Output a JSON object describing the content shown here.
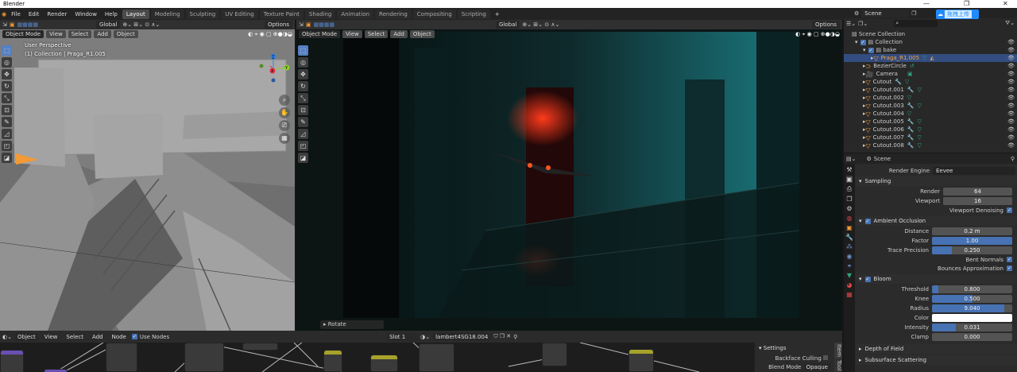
{
  "app": {
    "title": "Blender",
    "window_controls": [
      "—",
      "❐",
      "✕"
    ]
  },
  "menu": {
    "items": [
      "File",
      "Edit",
      "Render",
      "Window",
      "Help"
    ],
    "workspaces": [
      "Layout",
      "Modeling",
      "Sculpting",
      "UV Editing",
      "Texture Paint",
      "Shading",
      "Animation",
      "Rendering",
      "Compositing",
      "Scripting"
    ],
    "add_tab": "+"
  },
  "viewport_left": {
    "mode": "Object Mode",
    "menus": [
      "View",
      "Select",
      "Add",
      "Object"
    ],
    "transform": "Global",
    "options": "Options",
    "overlay_title": "User Perspective",
    "overlay_sub": "(1) Collection | Praga_R1.005",
    "gizmo": {
      "z": "Z",
      "y": "Y",
      "x": "X"
    }
  },
  "viewport_right": {
    "mode": "Object Mode",
    "menus": [
      "View",
      "Select",
      "Add",
      "Object"
    ],
    "transform": "Global",
    "options": "Options",
    "operator": "Rotate"
  },
  "node_editor": {
    "object": "Object",
    "menus": [
      "View",
      "Select",
      "Add",
      "Node"
    ],
    "use_nodes": "Use Nodes",
    "slot": "Slot 1",
    "material": "lambert4SG18.004",
    "npanel": {
      "section": "Settings",
      "backface": "Backface Culling",
      "blend_label": "Blend Mode",
      "blend_value": "Opaque",
      "tabs": [
        "Item",
        "Tool"
      ]
    }
  },
  "outliner": {
    "scene": "Scene",
    "upload_label": "拖拽上传",
    "root": "Scene Collection",
    "items": [
      {
        "name": "Collection",
        "type": "collection"
      },
      {
        "name": "bake",
        "type": "collection"
      },
      {
        "name": "Praga_R1.005",
        "type": "mesh",
        "selected": true
      },
      {
        "name": "BezierCircle",
        "type": "curve"
      },
      {
        "name": "Camera",
        "type": "camera"
      },
      {
        "name": "Cutout",
        "type": "mesh"
      },
      {
        "name": "Cutout.001",
        "type": "mesh"
      },
      {
        "name": "Cutout.002",
        "type": "mesh"
      },
      {
        "name": "Cutout.003",
        "type": "mesh"
      },
      {
        "name": "Cutout.004",
        "type": "mesh"
      },
      {
        "name": "Cutout.005",
        "type": "mesh"
      },
      {
        "name": "Cutout.006",
        "type": "mesh"
      },
      {
        "name": "Cutout.007",
        "type": "mesh"
      },
      {
        "name": "Cutout.008",
        "type": "mesh"
      }
    ]
  },
  "properties": {
    "context": "Scene",
    "render_engine_label": "Render Engine",
    "render_engine": "Eevee",
    "sampling": {
      "title": "Sampling",
      "render_label": "Render",
      "render": "64",
      "viewport_label": "Viewport",
      "viewport": "16",
      "denoise": "Viewport Denoising"
    },
    "ao": {
      "title": "Ambient Occlusion",
      "distance_label": "Distance",
      "distance": "0.2 m",
      "factor_label": "Factor",
      "factor": "1.00",
      "factor_fill": 1.0,
      "trace_label": "Trace Precision",
      "trace": "0.250",
      "trace_fill": 0.25,
      "bent": "Bent Normals",
      "bounces": "Bounces Approximation"
    },
    "bloom": {
      "title": "Bloom",
      "threshold_label": "Threshold",
      "threshold": "0.800",
      "threshold_fill": 0.08,
      "knee_label": "Knee",
      "knee": "0.500",
      "knee_fill": 0.5,
      "radius_label": "Radius",
      "radius": "9.040",
      "radius_fill": 0.9,
      "color_label": "Color",
      "intensity_label": "Intensity",
      "intensity": "0.031",
      "intensity_fill": 0.3,
      "clamp_label": "Clamp",
      "clamp": "0.000"
    },
    "collapsed": [
      "Depth of Field",
      "Subsurface Scattering"
    ]
  }
}
